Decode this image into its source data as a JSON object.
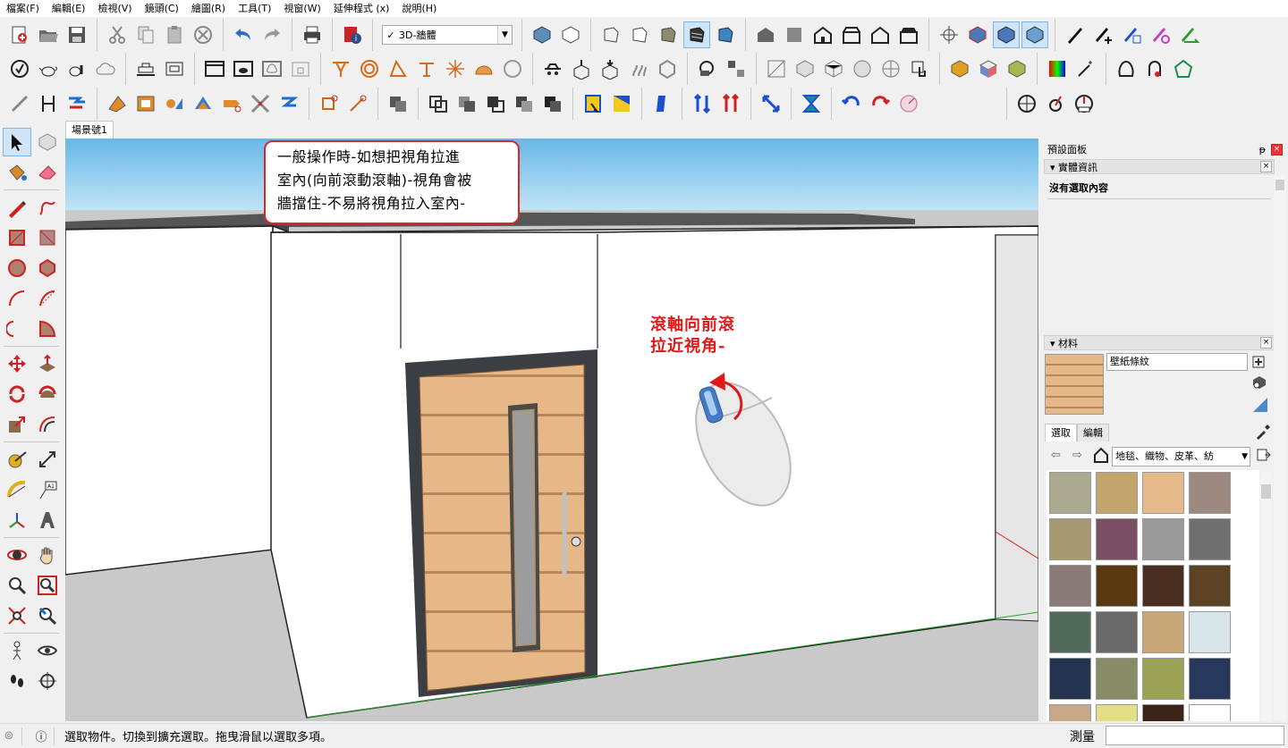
{
  "menu": [
    "檔案(F)",
    "編輯(E)",
    "檢視(V)",
    "鏡頭(C)",
    "繪圖(R)",
    "工具(T)",
    "視窗(W)",
    "延伸程式 (x)",
    "說明(H)"
  ],
  "toolbar": {
    "style_select_check": "✓",
    "style_select_value": "3D-牆體"
  },
  "scene_tab": "場景號1",
  "viewport": {
    "callout_lines": [
      "一般操作時-如想把視角拉進",
      "室內(向前滾動滾軸)-視角會被",
      "牆擋住-不易將視角拉入室內-"
    ],
    "red_label_lines": [
      "滾軸向前滾",
      "拉近視角-"
    ]
  },
  "tray": {
    "title": "預設面板",
    "entity_info": {
      "header": "▾ 實體資訊",
      "status": "沒有選取內容"
    },
    "materials": {
      "header": "▾ 材料",
      "name": "壁紙條紋",
      "tabs": [
        "選取",
        "編輯"
      ],
      "library": "地毯、織物、皮革、紡",
      "swatch_colors": [
        [
          "#a9aa90",
          "#c2a46c",
          "#e5b98a",
          "#9c8a80"
        ],
        [
          "#a89a70",
          "#7b4f62",
          "#9a9a9a",
          "#6f6f6f"
        ],
        [
          "#8a7a78",
          "#5a3812",
          "#4a2e22",
          "#5a4222"
        ],
        [
          "#526a5a",
          "#6a6a6a",
          "#c8a878",
          "#d8e6ea"
        ],
        [
          "#243450",
          "#888c66",
          "#9aa254",
          "#28385c"
        ],
        [
          "#c8a888",
          "#e4de88",
          "#3a2418",
          "#ffffff"
        ]
      ]
    },
    "close_glyph": "×",
    "pin_glyph": "ᵽ"
  },
  "status": {
    "message": "選取物件。切換到擴充選取。拖曳滑鼠以選取多項。",
    "measure_label": "測量"
  },
  "colors": {
    "sky_top": "#66b8e8",
    "sky_bottom": "#d8eef8",
    "ground": "#c9c9c9",
    "wall": "#ffffff",
    "door_frame": "#3b3e42",
    "door_wood": "#e6b888",
    "callout_border": "#d62828",
    "red_text": "#e01818"
  }
}
